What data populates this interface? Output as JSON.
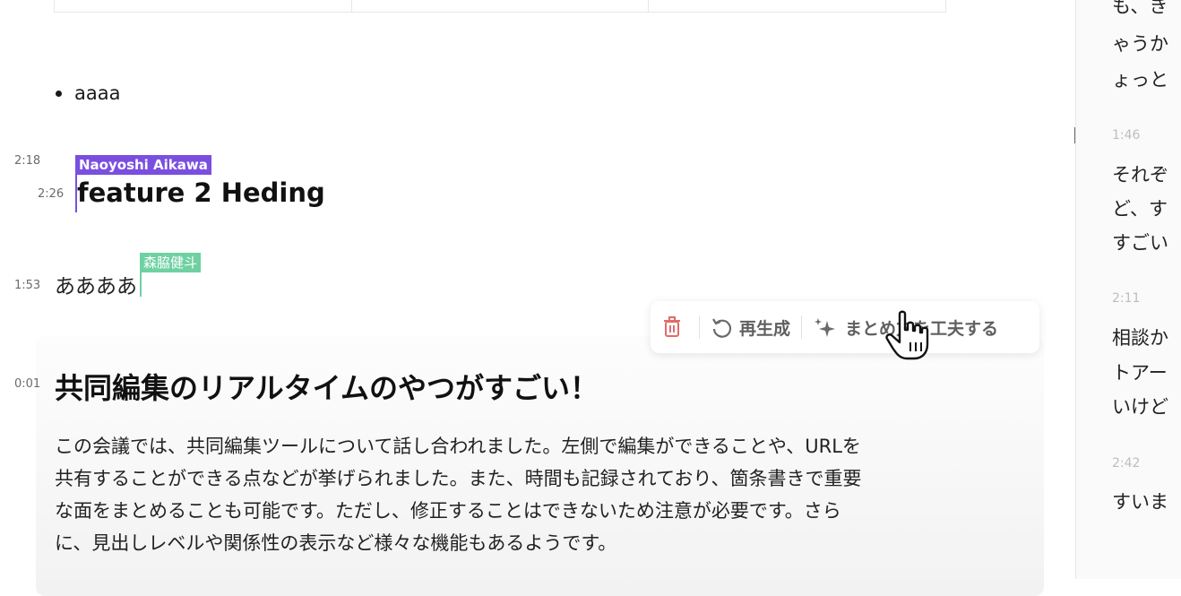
{
  "editor": {
    "bullet_text": "aaaa",
    "timestamps": {
      "heading_collab": "2:18",
      "heading_self": "2:26",
      "para": "1:53",
      "summary": "0:01"
    },
    "collaborators": {
      "purple_name": "Naoyoshi Aikawa",
      "green_name": "森脇健斗",
      "purple_color": "#7a4fe0",
      "green_color": "#6fd1a2"
    },
    "heading": "feature 2 Heding",
    "paragraph": "ああああ"
  },
  "toolbar": {
    "regenerate_label": "再生成",
    "improve_label": "まとめ方を工夫する"
  },
  "summary": {
    "title": "共同編集のリアルタイムのやつがすごい！",
    "body_lines": [
      "この会議では、共同編集ツールについて話し合われました。左側で編集ができることや、URLを",
      "共有することができる点などが挙げられました。また、時間も記録されており、箇条書きで重要",
      "な面をまとめることも可能です。ただし、修正することはできないため注意が必要です。さら",
      "に、見出しレベルや関係性の表示など様々な機能もあるようです。"
    ]
  },
  "transcript": {
    "lines": [
      "も、き",
      "ゃうか",
      "ょっと",
      "それぞ",
      "ど、す",
      "すごい",
      "相談か",
      "トアー",
      "いけど",
      "すいま"
    ],
    "times": [
      "1:46",
      "2:11",
      "2:42"
    ]
  }
}
